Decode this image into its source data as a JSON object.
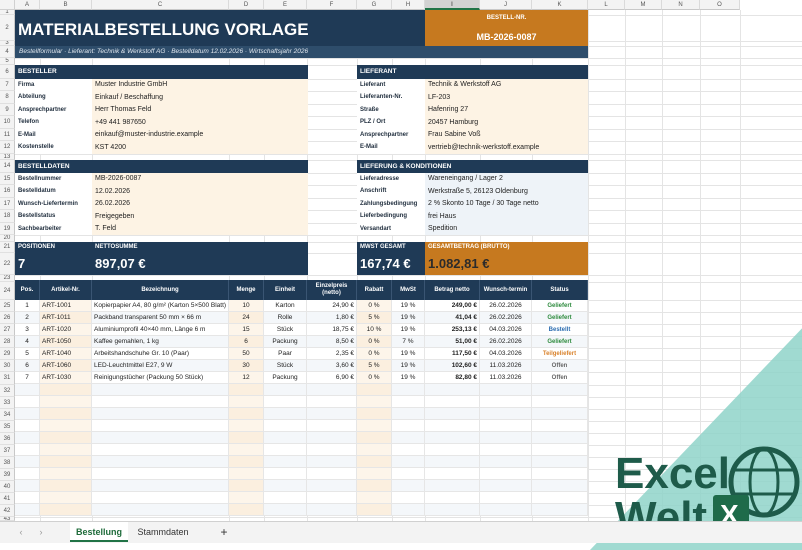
{
  "columns": [
    "A",
    "B",
    "C",
    "D",
    "E",
    "F",
    "G",
    "H",
    "I",
    "J",
    "K",
    "L",
    "M",
    "N",
    "O"
  ],
  "rows": [
    "1",
    "2",
    "3",
    "4",
    "5",
    "6",
    "7",
    "8",
    "9",
    "10",
    "11",
    "12",
    "13",
    "14",
    "15",
    "16",
    "17",
    "18",
    "19",
    "20",
    "21",
    "22",
    "23",
    "24",
    "25",
    "26",
    "27",
    "28",
    "29",
    "30",
    "31",
    "32",
    "33",
    "34",
    "35",
    "36",
    "37",
    "38",
    "39",
    "40",
    "41",
    "42",
    "43"
  ],
  "header": {
    "title": "MATERIALBESTELLUNG VORLAGE",
    "subtitle": "Bestellformular · Lieferant: Technik & Werkstoff AG   ·   Bestelldatum 12.02.2026   ·   Wirtschaftsjahr 2026",
    "order_no_label": "BESTELL-NR.",
    "order_no_value": "MB-2026-0087"
  },
  "besteller": {
    "heading": "BESTELLER",
    "rows": [
      {
        "label": "Firma",
        "value": "Muster Industrie GmbH"
      },
      {
        "label": "Abteilung",
        "value": "Einkauf / Beschaffung"
      },
      {
        "label": "Ansprechpartner",
        "value": "Herr Thomas Feld"
      },
      {
        "label": "Telefon",
        "value": "+49 441 987650"
      },
      {
        "label": "E-Mail",
        "value": "einkauf@muster-industrie.example"
      },
      {
        "label": "Kostenstelle",
        "value": "KST 4200"
      }
    ]
  },
  "lieferant": {
    "heading": "LIEFERANT",
    "rows": [
      {
        "label": "Lieferant",
        "value": "Technik & Werkstoff AG"
      },
      {
        "label": "Lieferanten-Nr.",
        "value": "LF-203"
      },
      {
        "label": "Straße",
        "value": "Hafenring 27"
      },
      {
        "label": "PLZ / Ort",
        "value": "20457 Hamburg"
      },
      {
        "label": "Ansprechpartner",
        "value": "Frau Sabine Voß"
      },
      {
        "label": "E-Mail",
        "value": "vertrieb@technik-werkstoff.example"
      }
    ]
  },
  "bestelldaten": {
    "heading": "BESTELLDATEN",
    "rows": [
      {
        "label": "Bestellnummer",
        "value": "MB-2026-0087"
      },
      {
        "label": "Bestelldatum",
        "value": "12.02.2026"
      },
      {
        "label": "Wunsch-Liefertermin",
        "value": "26.02.2026"
      },
      {
        "label": "Bestellstatus",
        "value": "Freigegeben"
      },
      {
        "label": "Sachbearbeiter",
        "value": "T. Feld"
      }
    ]
  },
  "lieferung": {
    "heading": "LIEFERUNG & KONDITIONEN",
    "rows": [
      {
        "label": "Lieferadresse",
        "value": "Wareneingang / Lager 2"
      },
      {
        "label": "Anschrift",
        "value": "Werkstraße 5, 26123 Oldenburg"
      },
      {
        "label": "Zahlungsbedingung",
        "value": "2 % Skonto 10 Tage / 30 Tage netto"
      },
      {
        "label": "Lieferbedingung",
        "value": "frei Haus"
      },
      {
        "label": "Versandart",
        "value": "Spedition"
      }
    ]
  },
  "kpis": {
    "positionen_label": "POSITIONEN",
    "positionen_value": "7",
    "netto_label": "NETTOSUMME",
    "netto_value": "897,07 €",
    "mwst_label": "MWST GESAMT",
    "mwst_value": "167,74 €",
    "brutto_label": "GESAMTBETRAG (BRUTTO)",
    "brutto_value": "1.082,81 €"
  },
  "table": {
    "headers": [
      "Pos.",
      "Artikel-Nr.",
      "Bezeichnung",
      "Menge",
      "Einheit",
      "Einzelpreis (netto)",
      "Rabatt",
      "MwSt",
      "Betrag netto",
      "Wunsch-termin",
      "Status"
    ],
    "rows": [
      [
        "1",
        "ART-1001",
        "Kopierpapier A4, 80 g/m² (Karton 5×500 Blatt)",
        "10",
        "Karton",
        "24,90 €",
        "0 %",
        "19 %",
        "249,00 €",
        "26.02.2026",
        "Geliefert"
      ],
      [
        "2",
        "ART-1011",
        "Packband transparent 50 mm × 66 m",
        "24",
        "Rolle",
        "1,80 €",
        "5 %",
        "19 %",
        "41,04 €",
        "26.02.2026",
        "Geliefert"
      ],
      [
        "3",
        "ART-1020",
        "Aluminiumprofil 40×40 mm, Länge 6 m",
        "15",
        "Stück",
        "18,75 €",
        "10 %",
        "19 %",
        "253,13 €",
        "04.03.2026",
        "Bestellt"
      ],
      [
        "4",
        "ART-1050",
        "Kaffee gemahlen, 1 kg",
        "6",
        "Packung",
        "8,50 €",
        "0 %",
        "7 %",
        "51,00 €",
        "26.02.2026",
        "Geliefert"
      ],
      [
        "5",
        "ART-1040",
        "Arbeitshandschuhe Gr. 10 (Paar)",
        "50",
        "Paar",
        "2,35 €",
        "0 %",
        "19 %",
        "117,50 €",
        "04.03.2026",
        "Teilgeliefert"
      ],
      [
        "6",
        "ART-1060",
        "LED-Leuchtmittel E27, 9 W",
        "30",
        "Stück",
        "3,60 €",
        "5 %",
        "19 %",
        "102,60 €",
        "11.03.2026",
        "Offen"
      ],
      [
        "7",
        "ART-1030",
        "Reinigungstücher (Packung 50 Stück)",
        "12",
        "Packung",
        "6,90 €",
        "0 %",
        "19 %",
        "82,80 €",
        "11.03.2026",
        "Offen"
      ]
    ]
  },
  "status_colors": {
    "Geliefert": "#2e8b3e",
    "Bestellt": "#2b6cb0",
    "Teilgeliefert": "#d9822b",
    "Offen": "#666666"
  },
  "tabs": {
    "active": "Bestellung",
    "other": "Stammdaten",
    "add": "+",
    "prev": "‹",
    "next": "›"
  },
  "watermark": {
    "line1": "Excel",
    "line2": "Welt",
    "badge": "X"
  }
}
